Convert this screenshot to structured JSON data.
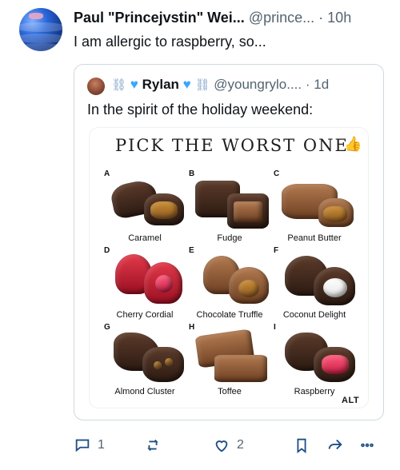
{
  "post": {
    "author_name": "Paul \"Princejvstin\" Wei...",
    "author_handle": "@prince...",
    "separator": "·",
    "time_ago": "10h",
    "text": "I am allergic to raspberry, so..."
  },
  "quote": {
    "name_prefix_emoji": "⛓",
    "name": "Rylan",
    "name_suffix_emoji": "⛓",
    "handle": "@youngrylo....",
    "separator": "·",
    "time_ago": "1d",
    "text": "In the spirit of the holiday weekend:",
    "media": {
      "title": "PICK THE WORST ONE",
      "thumb_icon": "thumbs-up-icon",
      "items": [
        {
          "letter": "A",
          "label": "Caramel"
        },
        {
          "letter": "B",
          "label": "Fudge"
        },
        {
          "letter": "C",
          "label": "Peanut Butter"
        },
        {
          "letter": "D",
          "label": "Cherry Cordial"
        },
        {
          "letter": "E",
          "label": "Chocolate Truffle"
        },
        {
          "letter": "F",
          "label": "Coconut Delight"
        },
        {
          "letter": "G",
          "label": "Almond Cluster"
        },
        {
          "letter": "H",
          "label": "Toffee"
        },
        {
          "letter": "I",
          "label": "Raspberry"
        }
      ],
      "alt_badge": "ALT"
    }
  },
  "actions": {
    "reply_count": "1",
    "repost_count": "",
    "like_count": "2",
    "icons": [
      "reply-icon",
      "repost-icon",
      "like-icon",
      "bookmark-icon",
      "share-icon",
      "more-icon"
    ]
  },
  "colors": {
    "text": "#0f1419",
    "muted": "#536471",
    "border": "#cfd9de",
    "icon_stroke": "#1d4f86",
    "thumb_blue": "#2a7ad8"
  }
}
